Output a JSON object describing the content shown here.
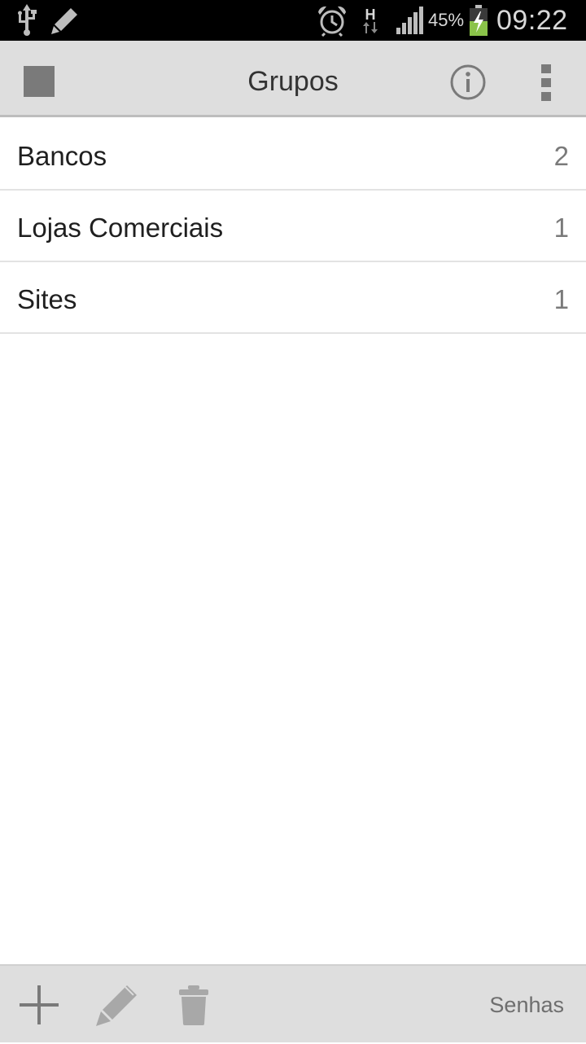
{
  "status_bar": {
    "icons": [
      "usb-icon",
      "edit-icon",
      "alarm-icon",
      "hspa-data-icon",
      "signal-icon",
      "battery-charging-icon"
    ],
    "network_type": "H",
    "battery_percent": "45%",
    "time": "09:22"
  },
  "action_bar": {
    "title": "Grupos",
    "icons": [
      "app-icon",
      "info-icon",
      "overflow-menu-icon"
    ]
  },
  "groups": [
    {
      "name": "Bancos",
      "count": "2"
    },
    {
      "name": "Lojas Comerciais",
      "count": "1"
    },
    {
      "name": "Sites",
      "count": "1"
    }
  ],
  "bottom_bar": {
    "icons": [
      "add-icon",
      "edit-icon",
      "trash-icon"
    ],
    "senhas_label": "Senhas"
  },
  "colors": {
    "status_bar_bg": "#000000",
    "action_bar_bg": "#dedede",
    "icon_gray": "#7a7a7a",
    "battery_green": "#8bc34a"
  }
}
